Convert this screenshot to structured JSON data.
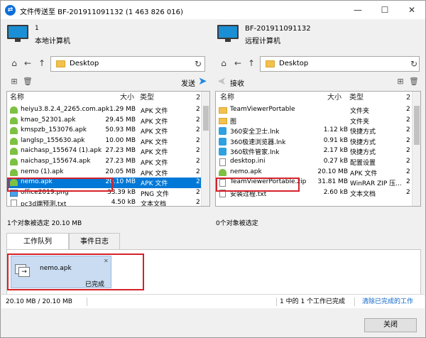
{
  "window": {
    "title": "文件传送至 BF-201911091132 (1 463 826 016)",
    "buttons": {
      "minimize": "—",
      "maximize": "☐",
      "close": "✕"
    }
  },
  "local": {
    "line1": "1",
    "line2": "本地计算机",
    "path": "Desktop",
    "send_label": "发送",
    "col_name": "名称",
    "col_size": "大小",
    "col_type": "类型",
    "col_more": "2",
    "status": "1个对象被选定  20.10 MB",
    "rows": [
      {
        "name": "heiyu3.8.2.4_2265.com.apk",
        "size": "1.29 MB",
        "type": "APK 文件",
        "extra": "2",
        "icon": "apk"
      },
      {
        "name": "kmao_52301.apk",
        "size": "29.45 MB",
        "type": "APK 文件",
        "extra": "2",
        "icon": "apk"
      },
      {
        "name": "kmspzb_153076.apk",
        "size": "50.93 MB",
        "type": "APK 文件",
        "extra": "2",
        "icon": "apk"
      },
      {
        "name": "langlsp_155630.apk",
        "size": "10.00 MB",
        "type": "APK 文件",
        "extra": "2",
        "icon": "apk"
      },
      {
        "name": "naichasp_155674 (1).apk",
        "size": "27.23 MB",
        "type": "APK 文件",
        "extra": "2",
        "icon": "apk"
      },
      {
        "name": "naichasp_155674.apk",
        "size": "27.23 MB",
        "type": "APK 文件",
        "extra": "2",
        "icon": "apk"
      },
      {
        "name": "nemo (1).apk",
        "size": "20.05 MB",
        "type": "APK 文件",
        "extra": "2",
        "icon": "apk"
      },
      {
        "name": "nemo.apk",
        "size": "20.10 MB",
        "type": "APK 文件",
        "extra": "2",
        "icon": "apk",
        "selected": true
      },
      {
        "name": "office2019.png",
        "size": "33.39 kB",
        "type": "PNG 文件",
        "extra": "2",
        "icon": "png"
      },
      {
        "name": "pc3d端预测.txt",
        "size": "4.50 kB",
        "type": "文本文档",
        "extra": "2",
        "icon": "doc"
      }
    ]
  },
  "remote": {
    "line1": "BF-201911091132",
    "line2": "远程计算机",
    "path": "Desktop",
    "receive_label": "接收",
    "col_name": "名称",
    "col_size": "大小",
    "col_type": "类型",
    "col_more": "2",
    "status": "0个对象被选定",
    "rows": [
      {
        "name": "TeamViewerPortable",
        "size": "",
        "type": "文件夹",
        "extra": "2",
        "icon": "folder"
      },
      {
        "name": "图",
        "size": "",
        "type": "文件夹",
        "extra": "2",
        "icon": "folder"
      },
      {
        "name": "360安全卫士.lnk",
        "size": "1.12 kB",
        "type": "快捷方式",
        "extra": "2",
        "icon": "lnk"
      },
      {
        "name": "360极速浏览器.lnk",
        "size": "0.91 kB",
        "type": "快捷方式",
        "extra": "2",
        "icon": "lnk"
      },
      {
        "name": "360软件管家.lnk",
        "size": "2.17 kB",
        "type": "快捷方式",
        "extra": "2",
        "icon": "lnk"
      },
      {
        "name": "desktop.ini",
        "size": "0.27 kB",
        "type": "配置设置",
        "extra": "2",
        "icon": "doc"
      },
      {
        "name": "nemo.apk",
        "size": "20.10 MB",
        "type": "APK 文件",
        "extra": "2",
        "icon": "apk"
      },
      {
        "name": "TeamViewerPortable.zip",
        "size": "31.81 MB",
        "type": "WinRAR ZIP 压...",
        "extra": "2",
        "icon": "doc"
      },
      {
        "name": "安装过程.txt",
        "size": "2.60 kB",
        "type": "文本文档",
        "extra": "2",
        "icon": "doc"
      }
    ]
  },
  "tabs": {
    "queue": "工作队列",
    "log": "事件日志"
  },
  "job": {
    "name": "nemo.apk",
    "status": "已完成",
    "close": "✕"
  },
  "statusbar": {
    "progress": "20.10 MB / 20.10 MB",
    "summary": "1 中的 1 个工作已完成",
    "clear_link": "清除已完成的工作"
  },
  "close_button": "关闭",
  "colors": {
    "selection": "#0078d7",
    "highlight_box": "#d6222a",
    "link": "#0a64c8"
  }
}
